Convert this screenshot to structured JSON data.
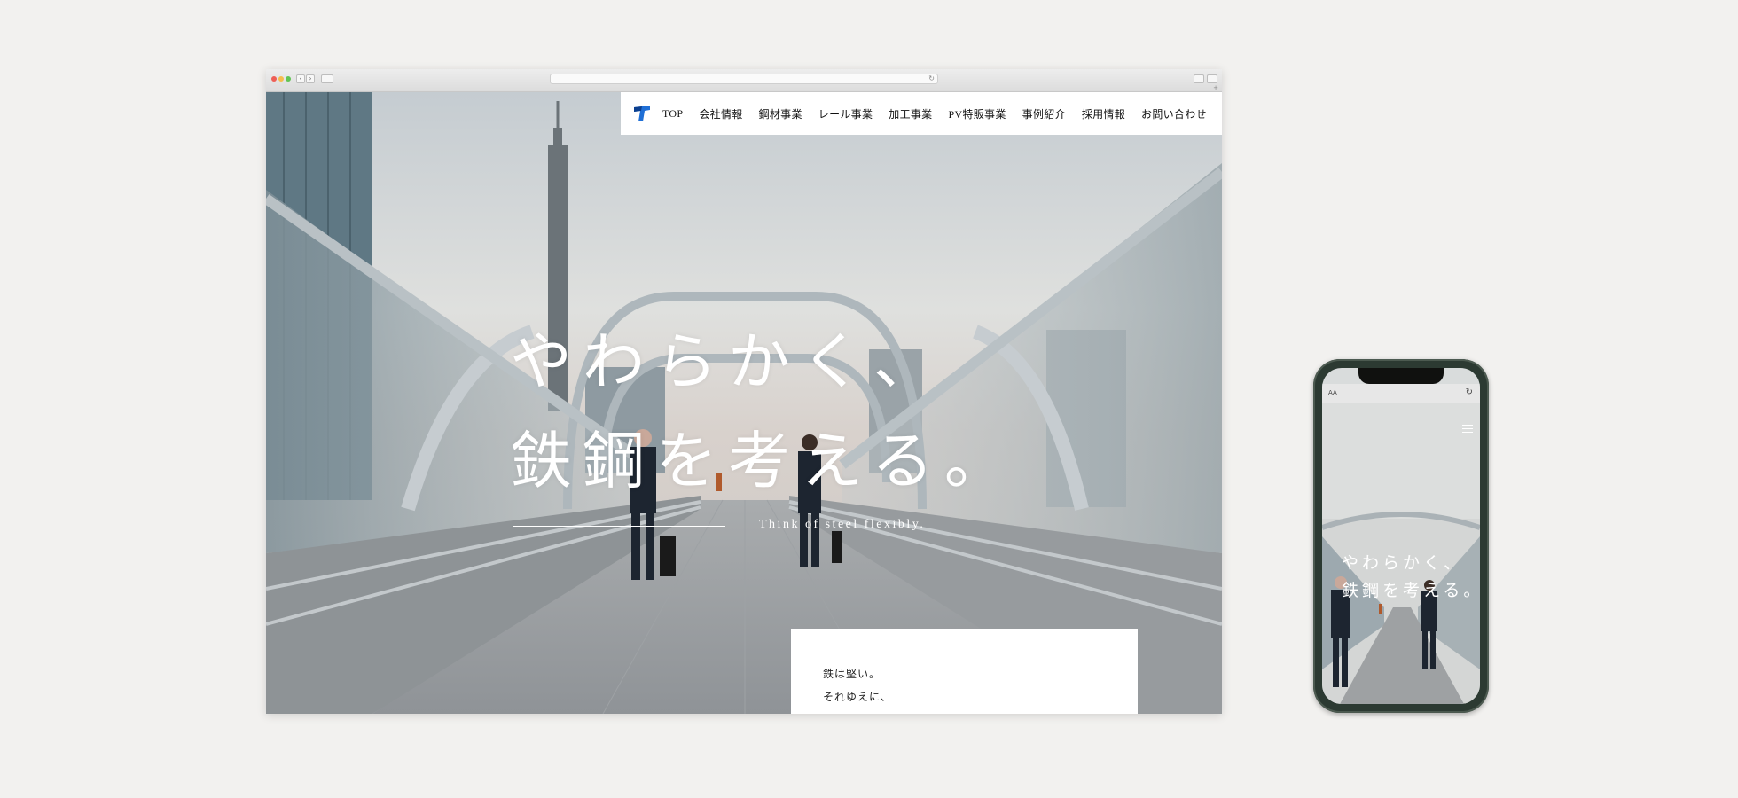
{
  "site": {
    "nav": [
      "TOP",
      "会社情報",
      "鋼材事業",
      "レール事業",
      "加工事業",
      "PV特販事業",
      "事例紹介",
      "採用情報",
      "お問い合わせ"
    ],
    "logo_icon": "t-mark-logo",
    "brand_color": "#1f6fd6"
  },
  "hero": {
    "title_line1": "やわらかく、",
    "title_line2": "鉄鋼を考える。",
    "subtitle": "Think of steel flexibly."
  },
  "intro": {
    "line1": "鉄は堅い。",
    "line2": "それゆえに、"
  },
  "mobile": {
    "url_label": "AA",
    "title_line1": "やわらかく、",
    "title_line2": "鉄鋼を考える。"
  }
}
